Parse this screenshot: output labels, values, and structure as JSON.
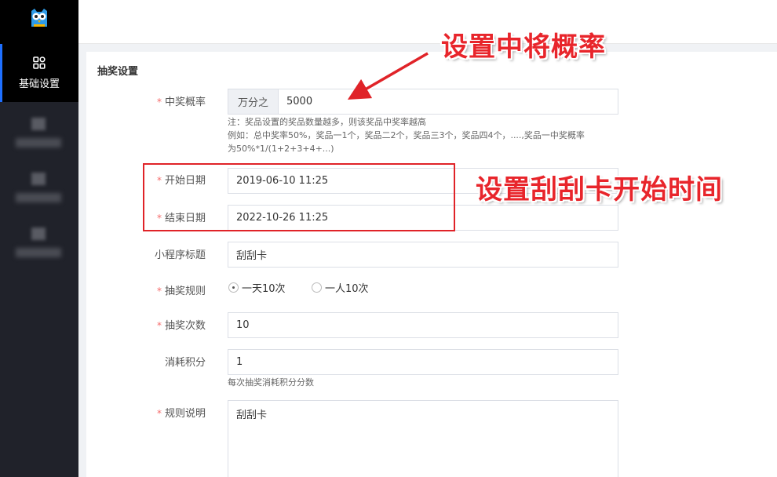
{
  "sidebar": {
    "active_item": {
      "label": "基础设置",
      "icon": "grid-icon"
    }
  },
  "section": {
    "title": "抽奖设置"
  },
  "form": {
    "win_rate": {
      "label": "中奖概率",
      "prefix": "万分之",
      "value": "5000"
    },
    "win_rate_hint": {
      "line1": "注：奖品设置的奖品数量越多，则该奖品中奖率越高",
      "line2": "例如：总中奖率50%，奖品一1个，奖品二2个，奖品三3个，奖品四4个，....,奖品一中奖概率",
      "line3": "为50%*1/(1+2+3+4+...)"
    },
    "start_date": {
      "label": "开始日期",
      "value": "2019-06-10 11:25"
    },
    "end_date": {
      "label": "结束日期",
      "value": "2022-10-26 11:25"
    },
    "mini_title": {
      "label": "小程序标题",
      "value": "刮刮卡"
    },
    "rule": {
      "label": "抽奖规则",
      "options": [
        {
          "label": "一天10次",
          "selected": true
        },
        {
          "label": "一人10次",
          "selected": false
        }
      ]
    },
    "draw_count": {
      "label": "抽奖次数",
      "value": "10"
    },
    "points": {
      "label": "消耗积分",
      "value": "1",
      "hint": "每次抽奖消耗积分分数"
    },
    "description": {
      "label": "规则说明",
      "value": "刮刮卡"
    },
    "required_mark": "*"
  },
  "annotations": {
    "rate_note": "设置中将概率",
    "date_note": "设置刮刮卡开始时间"
  },
  "colors": {
    "annotation": "#e8252b",
    "sidebar": "#20222a",
    "accent": "#1e6fff"
  }
}
